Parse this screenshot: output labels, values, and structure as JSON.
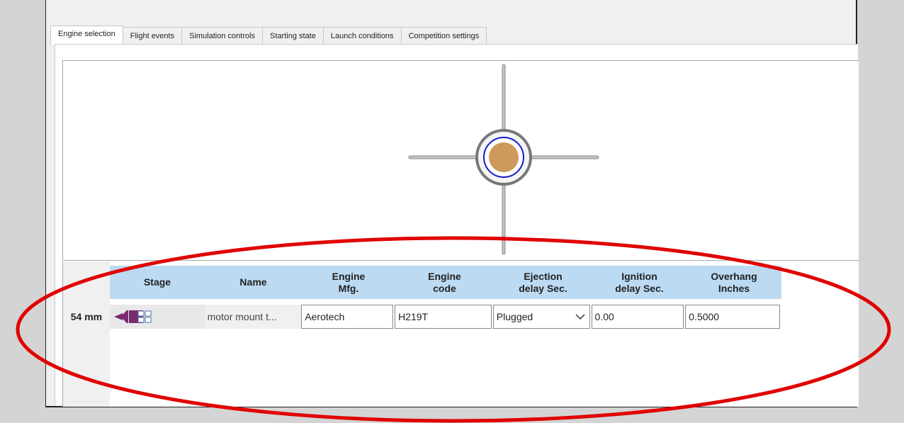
{
  "tabs": [
    {
      "label": "Engine selection",
      "active": true
    },
    {
      "label": "Flight events",
      "active": false
    },
    {
      "label": "Simulation controls",
      "active": false
    },
    {
      "label": "Starting state",
      "active": false
    },
    {
      "label": "Launch conditions",
      "active": false
    },
    {
      "label": "Competition settings",
      "active": false
    }
  ],
  "grid": {
    "headers": {
      "stage": "Stage",
      "name": "Name",
      "engine_mfg_line1": "Engine",
      "engine_mfg_line2": "Mfg.",
      "engine_code_line1": "Engine",
      "engine_code_line2": "code",
      "ejection_line1": "Ejection",
      "ejection_line2": "delay Sec.",
      "ignition_line1": "Ignition",
      "ignition_line2": "delay Sec.",
      "overhang_line1": "Overhang",
      "overhang_line2": "Inches"
    },
    "row": {
      "label": "54 mm",
      "name": "motor mount t...",
      "engine_mfg": "Aerotech",
      "engine_code": "H219T",
      "ejection_delay": "Plugged",
      "ignition_delay": "0.00",
      "overhang": "0.5000"
    }
  },
  "colors": {
    "header_bg": "#bcdaf2",
    "motor_fill": "#cd9a5b",
    "inner_ring": "#1a1ac8",
    "annotation": "#e00000",
    "stage_icon": "#7a2a6e"
  }
}
